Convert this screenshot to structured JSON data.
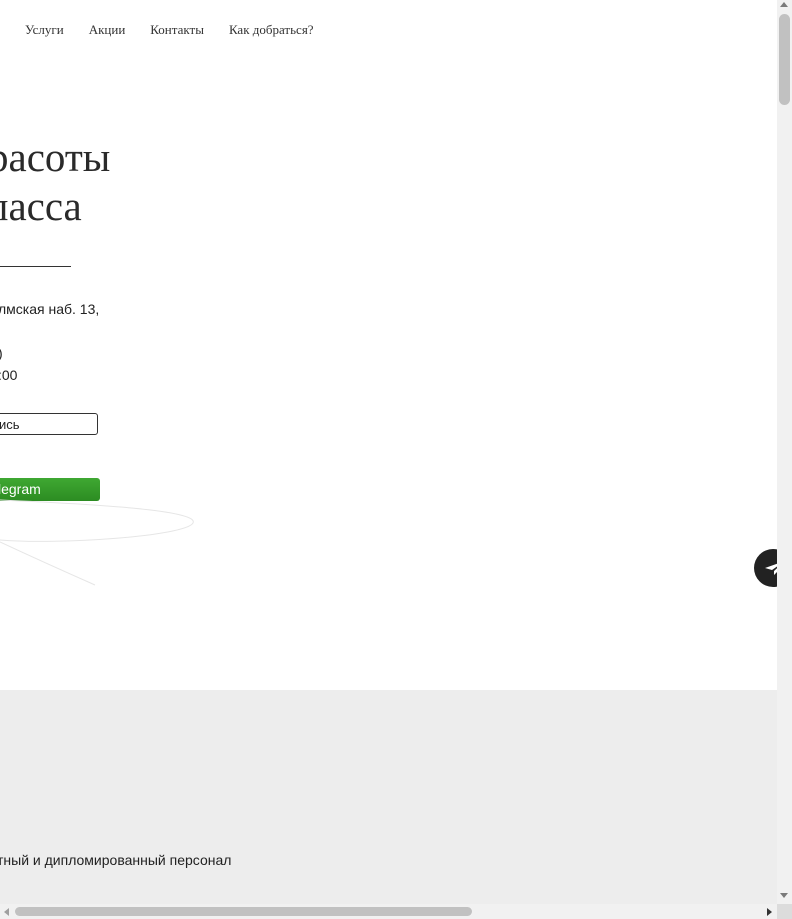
{
  "nav": {
    "items": [
      "Услуги",
      "Акции",
      "Контакты",
      "Как добраться?"
    ]
  },
  "hero": {
    "title_line1": "расоты",
    "title_line2": "ласса"
  },
  "contact": {
    "address": "лмская наб. 13,",
    "phone_fragment": ")",
    "hours": ":00"
  },
  "buttons": {
    "book_label": "ись",
    "telegram_label": "legram"
  },
  "gray_section": {
    "mark": ":",
    "text": "тный и дипломированный персонал"
  },
  "colors": {
    "telegram_button": "#2c8c22",
    "gray_background": "#ededed",
    "floating_button": "#222222"
  },
  "icons": {
    "floating": "telegram-icon"
  }
}
